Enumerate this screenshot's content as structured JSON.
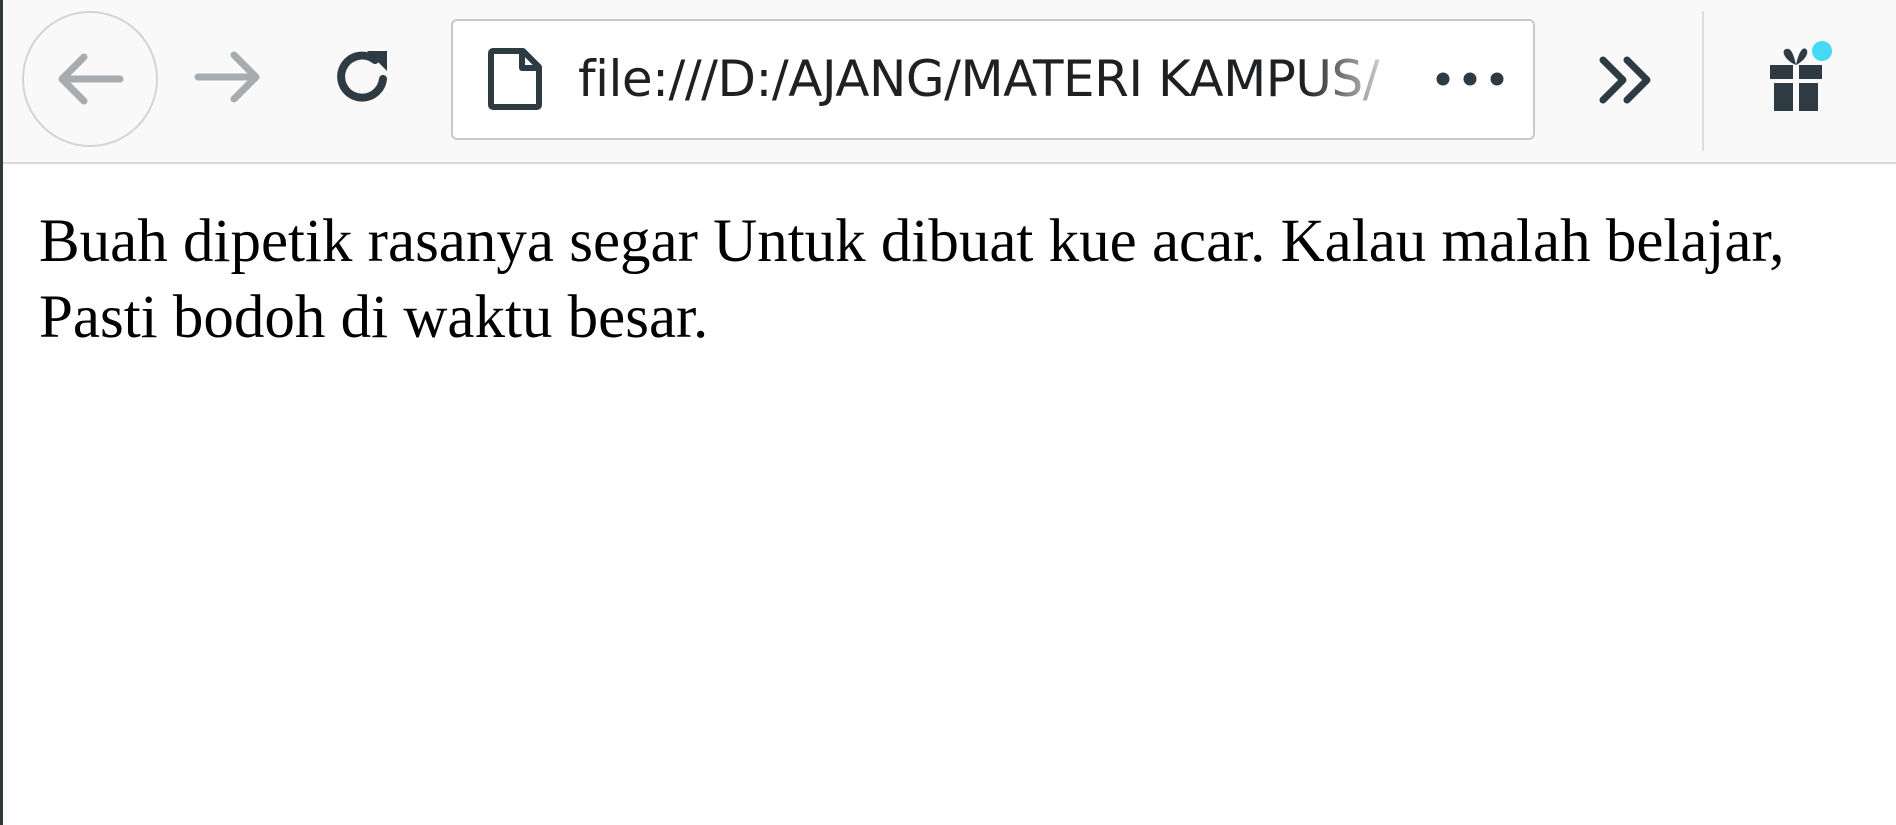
{
  "toolbar": {
    "url": "file:///D:/AJANG/MATERI KAMPUS/",
    "icons": {
      "back": "back-arrow-icon",
      "forward": "forward-arrow-icon",
      "reload": "reload-icon",
      "page": "page-icon",
      "page_actions": "more-dots-icon",
      "overflow": "chevron-double-right-icon",
      "whats_new": "gift-icon"
    },
    "colors": {
      "toolbar_bg": "#f9f9fa",
      "icon_active": "#2f3b43",
      "icon_disabled": "#a7acb0",
      "notification_dot": "#45d9f5"
    }
  },
  "page": {
    "text": "Buah dipetik rasanya segar Untuk dibuat kue acar. Kalau malah belajar, Pasti bodoh di waktu besar."
  }
}
